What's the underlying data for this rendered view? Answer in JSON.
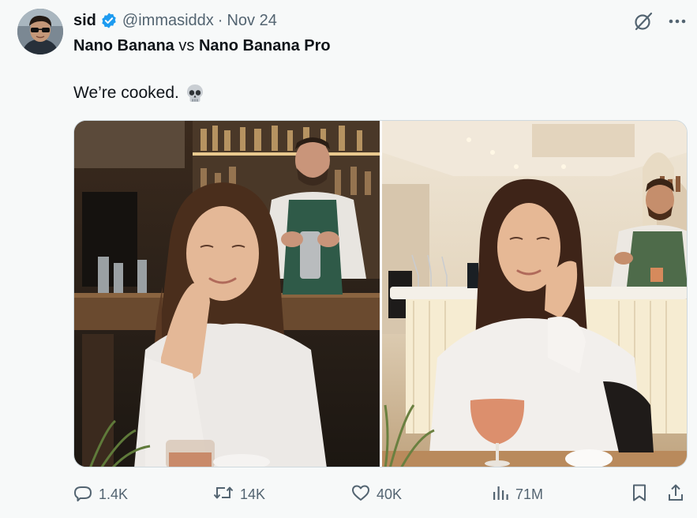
{
  "author": {
    "display_name": "sid",
    "handle": "@immasiddx",
    "separator": "·",
    "date": "Nov 24",
    "verified": true,
    "verified_color": "#1d9bf0"
  },
  "post": {
    "title_parts": [
      "Nano Banana",
      " vs ",
      "Nano Banana Pro"
    ],
    "text": "We’re cooked.",
    "emoji": "skull"
  },
  "media": [
    {
      "label": "Nano Banana image",
      "scene": "woman resting chin on hand at bar counter, bartender in green apron behind"
    },
    {
      "label": "Nano Banana Pro image",
      "scene": "woman resting chin on hand with cocktail, bartender at lit bar counter behind"
    }
  ],
  "actions": {
    "replies": "1.4K",
    "reposts": "14K",
    "likes": "40K",
    "views": "71M"
  },
  "icons": [
    "grok-icon",
    "more-icon",
    "reply-icon",
    "repost-icon",
    "like-icon",
    "views-icon",
    "bookmark-icon",
    "share-icon"
  ],
  "colors": {
    "text": "#0f1419",
    "muted": "#536471",
    "accent": "#1d9bf0",
    "background": "#f7f9f9"
  }
}
